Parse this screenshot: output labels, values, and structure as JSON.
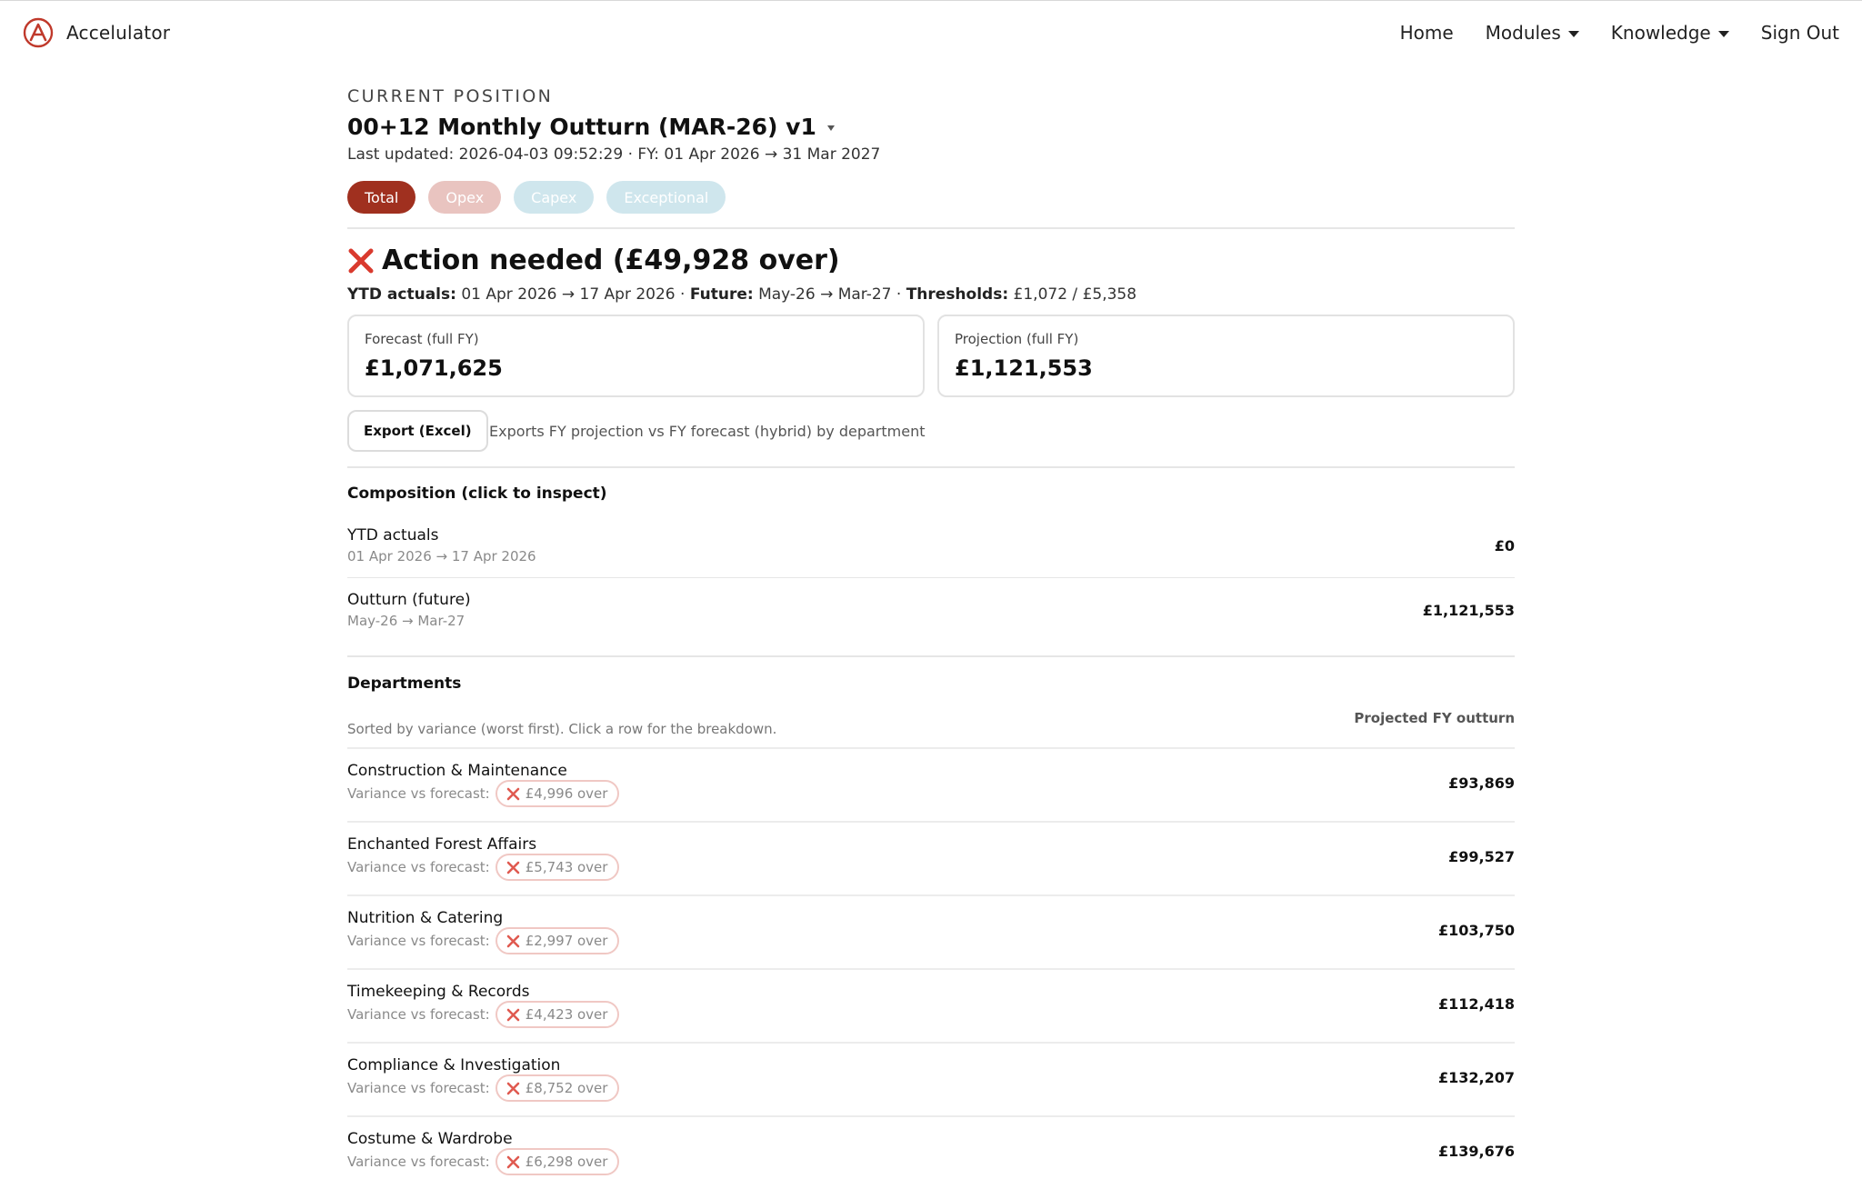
{
  "app": {
    "name": "Accelulator"
  },
  "nav": [
    {
      "label": "Home",
      "has_caret": false
    },
    {
      "label": "Modules",
      "has_caret": true
    },
    {
      "label": "Knowledge",
      "has_caret": true
    },
    {
      "label": "Sign Out",
      "has_caret": false
    }
  ],
  "header": {
    "eyebrow": "CURRENT POSITION",
    "title": "00+12 Monthly Outturn (MAR-26) v1",
    "meta": "Last updated: 2026-04-03 09:52:29 · FY: 01 Apr 2026 → 31 Mar 2027"
  },
  "tabs": [
    {
      "label": "Total",
      "active": true
    },
    {
      "label": "Opex",
      "active": false
    },
    {
      "label": "Capex",
      "active": false
    },
    {
      "label": "Exceptional",
      "active": false
    }
  ],
  "status": {
    "title": "Action needed (£49,928 over)",
    "ytd_label": "YTD actuals:",
    "ytd_value": "01 Apr 2026 → 17 Apr 2026",
    "future_label": "Future:",
    "future_value": "May-26 → Mar-27",
    "thresholds_label": "Thresholds:",
    "thresholds_value": "£1,072 / £5,358",
    "sep": " · "
  },
  "cards": {
    "forecast": {
      "label": "Forecast (full FY)",
      "value": "£1,071,625"
    },
    "projection": {
      "label": "Projection (full FY)",
      "value": "£1,121,553"
    }
  },
  "export": {
    "button_label": "Export (Excel)",
    "note": "Exports FY projection vs FY forecast (hybrid) by department"
  },
  "composition": {
    "title": "Composition (click to inspect)",
    "rows": [
      {
        "label": "YTD actuals",
        "sub": "01 Apr 2026 → 17 Apr 2026",
        "value": "£0"
      },
      {
        "label": "Outturn (future)",
        "sub": "May-26 → Mar-27",
        "value": "£1,121,553"
      }
    ]
  },
  "departments": {
    "title": "Departments",
    "sort_note": "Sorted by variance (worst first). Click a row for the breakdown.",
    "column_header": "Projected FY outturn",
    "variance_label": "Variance vs forecast:",
    "rows": [
      {
        "name": "Construction & Maintenance",
        "variance": "£4,996 over",
        "value": "£93,869"
      },
      {
        "name": "Enchanted Forest Affairs",
        "variance": "£5,743 over",
        "value": "£99,527"
      },
      {
        "name": "Nutrition & Catering",
        "variance": "£2,997 over",
        "value": "£103,750"
      },
      {
        "name": "Timekeeping & Records",
        "variance": "£4,423 over",
        "value": "£112,418"
      },
      {
        "name": "Compliance & Investigation",
        "variance": "£8,752 over",
        "value": "£132,207"
      },
      {
        "name": "Costume & Wardrobe",
        "variance": "£6,298 over",
        "value": "£139,676"
      }
    ]
  },
  "colors": {
    "accent": "#a0301f",
    "danger": "#d93a2e",
    "tab_opex": "#e9c4c0",
    "tab_capex": "#cfe6ed"
  }
}
